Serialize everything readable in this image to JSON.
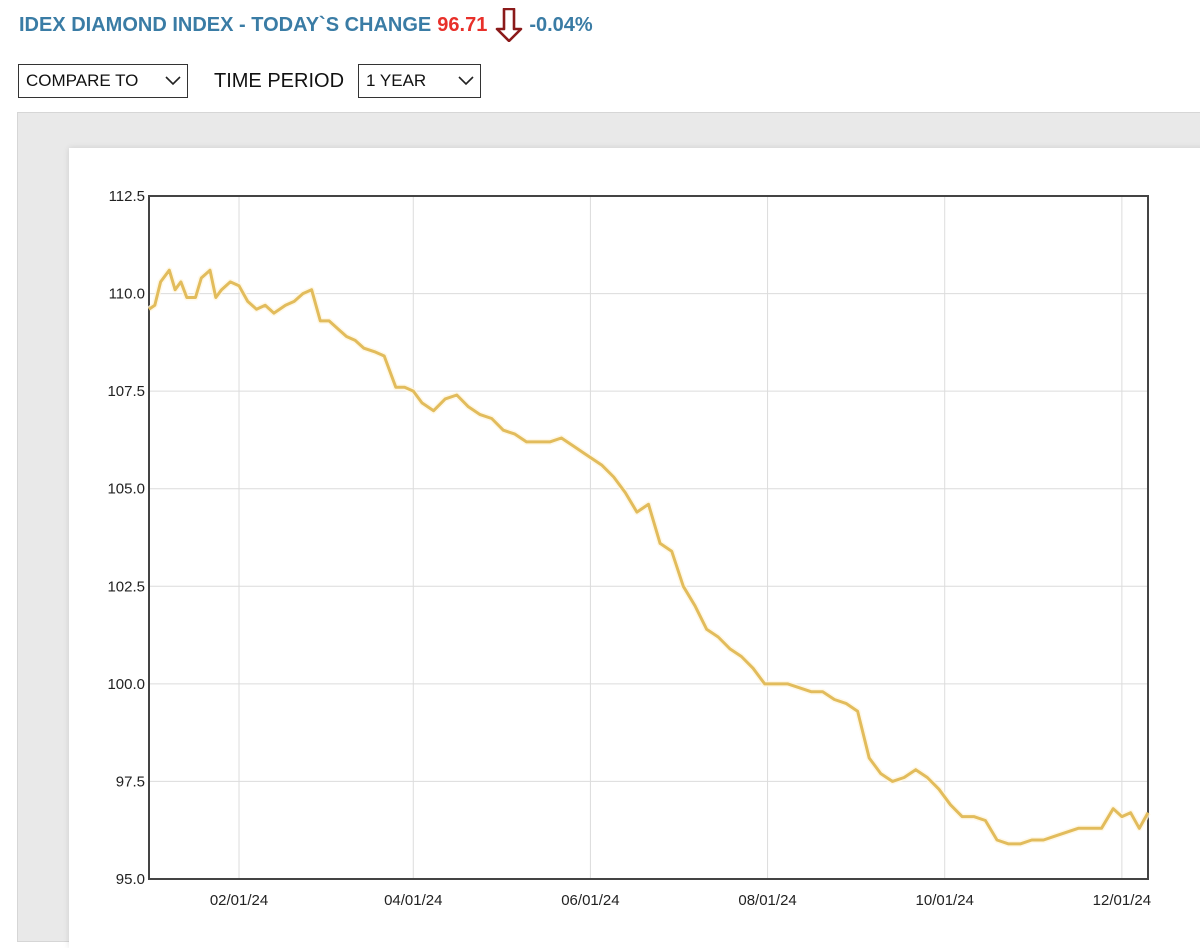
{
  "header": {
    "title": "IDEX DIAMOND INDEX - TODAY`S CHANGE",
    "price": "96.71",
    "change_pct": "-0.04%",
    "arrow_icon": "down-arrow-icon",
    "colors": {
      "title": "#3a7ca5",
      "price": "#e8302a",
      "arrow": "#8b1a1a"
    }
  },
  "controls": {
    "compare_label": "COMPARE TO",
    "period_label": "TIME PERIOD",
    "period_value": "1 YEAR"
  },
  "chart_data": {
    "type": "line",
    "title": "",
    "xlabel": "",
    "ylabel": "",
    "ylim": [
      95.0,
      112.5
    ],
    "yticks": [
      "95.0",
      "97.5",
      "100.0",
      "102.5",
      "105.0",
      "107.5",
      "110.0",
      "112.5"
    ],
    "xlim": [
      "2024-01-01",
      "2024-12-10"
    ],
    "xticks": [
      {
        "date": "2024-02-01",
        "label": "02/01/24"
      },
      {
        "date": "2024-04-01",
        "label": "04/01/24"
      },
      {
        "date": "2024-06-01",
        "label": "06/01/24"
      },
      {
        "date": "2024-08-01",
        "label": "08/01/24"
      },
      {
        "date": "2024-10-01",
        "label": "10/01/24"
      },
      {
        "date": "2024-12-01",
        "label": "12/01/24"
      }
    ],
    "grid": true,
    "line_color": "#e2bc5c",
    "series": [
      {
        "x": [
          "2024-01-01",
          "2024-01-03",
          "2024-01-05",
          "2024-01-08",
          "2024-01-10",
          "2024-01-12",
          "2024-01-14",
          "2024-01-17",
          "2024-01-19",
          "2024-01-22",
          "2024-01-24",
          "2024-01-26",
          "2024-01-29",
          "2024-02-01",
          "2024-02-04",
          "2024-02-07",
          "2024-02-10",
          "2024-02-13",
          "2024-02-17",
          "2024-02-20",
          "2024-02-23",
          "2024-02-26",
          "2024-02-29",
          "2024-03-03",
          "2024-03-06",
          "2024-03-09",
          "2024-03-12",
          "2024-03-15",
          "2024-03-19",
          "2024-03-22",
          "2024-03-26",
          "2024-03-29",
          "2024-04-01",
          "2024-04-04",
          "2024-04-08",
          "2024-04-12",
          "2024-04-16",
          "2024-04-20",
          "2024-04-24",
          "2024-04-28",
          "2024-05-02",
          "2024-05-06",
          "2024-05-10",
          "2024-05-14",
          "2024-05-18",
          "2024-05-22",
          "2024-05-26",
          "2024-05-30",
          "2024-06-01",
          "2024-06-05",
          "2024-06-09",
          "2024-06-13",
          "2024-06-17",
          "2024-06-21",
          "2024-06-25",
          "2024-06-29",
          "2024-07-03",
          "2024-07-07",
          "2024-07-11",
          "2024-07-15",
          "2024-07-19",
          "2024-07-23",
          "2024-07-27",
          "2024-07-31",
          "2024-08-04",
          "2024-08-08",
          "2024-08-12",
          "2024-08-16",
          "2024-08-20",
          "2024-08-24",
          "2024-08-28",
          "2024-09-01",
          "2024-09-05",
          "2024-09-09",
          "2024-09-13",
          "2024-09-17",
          "2024-09-21",
          "2024-09-25",
          "2024-09-29",
          "2024-10-03",
          "2024-10-07",
          "2024-10-11",
          "2024-10-15",
          "2024-10-19",
          "2024-10-23",
          "2024-10-27",
          "2024-10-31",
          "2024-11-04",
          "2024-11-08",
          "2024-11-12",
          "2024-11-16",
          "2024-11-20",
          "2024-11-24",
          "2024-11-28",
          "2024-12-01",
          "2024-12-04",
          "2024-12-07",
          "2024-12-10"
        ],
        "y": [
          109.6,
          109.7,
          110.3,
          110.6,
          110.1,
          110.3,
          109.9,
          109.9,
          110.4,
          110.6,
          109.9,
          110.1,
          110.3,
          110.2,
          109.8,
          109.6,
          109.7,
          109.5,
          109.7,
          109.8,
          110.0,
          110.1,
          109.3,
          109.3,
          109.1,
          108.9,
          108.8,
          108.6,
          108.5,
          108.4,
          107.6,
          107.6,
          107.5,
          107.2,
          107.0,
          107.3,
          107.4,
          107.1,
          106.9,
          106.8,
          106.5,
          106.4,
          106.2,
          106.2,
          106.2,
          106.3,
          106.1,
          105.9,
          105.8,
          105.6,
          105.3,
          104.9,
          104.4,
          104.6,
          103.6,
          103.4,
          102.5,
          102.0,
          101.4,
          101.2,
          100.9,
          100.7,
          100.4,
          100.0,
          100.0,
          100.0,
          99.9,
          99.8,
          99.8,
          99.6,
          99.5,
          99.3,
          98.1,
          97.7,
          97.5,
          97.6,
          97.8,
          97.6,
          97.3,
          96.9,
          96.6,
          96.6,
          96.5,
          96.0,
          95.9,
          95.9,
          96.0,
          96.0,
          96.1,
          96.2,
          96.3,
          96.3,
          96.3,
          96.8,
          96.6,
          96.7,
          96.3,
          96.7
        ]
      }
    ]
  }
}
